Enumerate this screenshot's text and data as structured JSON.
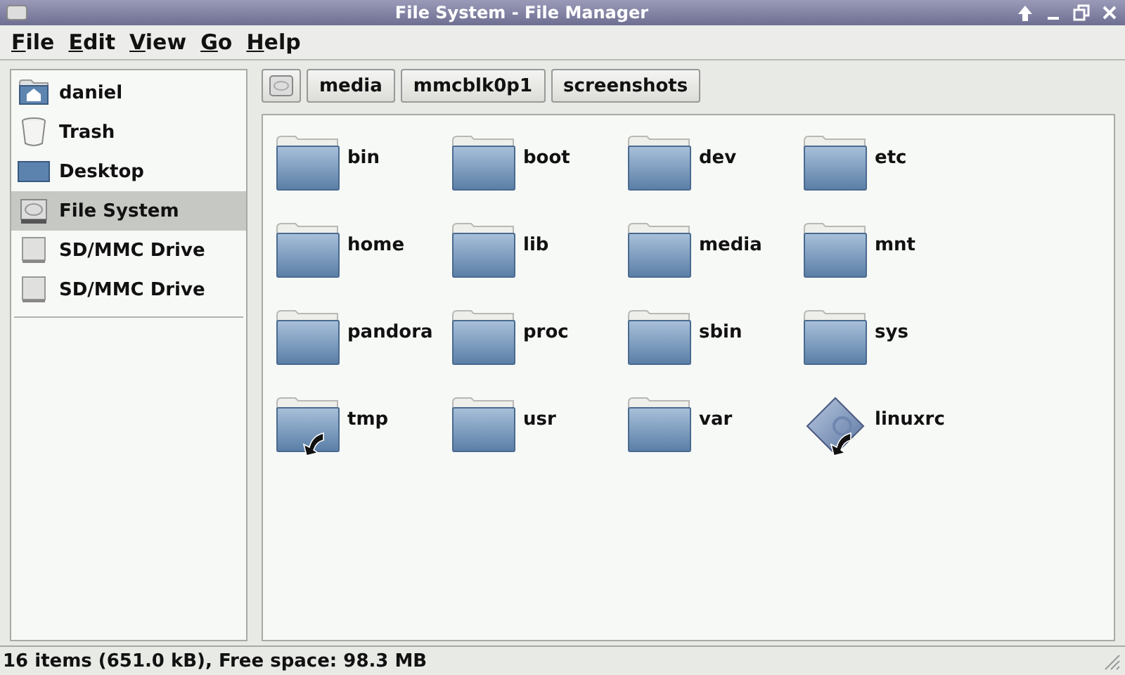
{
  "window": {
    "title": "File System - File Manager"
  },
  "menu": [
    {
      "label": "File"
    },
    {
      "label": "Edit"
    },
    {
      "label": "View"
    },
    {
      "label": "Go"
    },
    {
      "label": "Help"
    }
  ],
  "sidebar": {
    "items": [
      {
        "label": "daniel",
        "kind": "home",
        "selected": false
      },
      {
        "label": "Trash",
        "kind": "trash",
        "selected": false
      },
      {
        "label": "Desktop",
        "kind": "desktop",
        "selected": false
      },
      {
        "label": "File System",
        "kind": "drive",
        "selected": true
      },
      {
        "label": "SD/MMC Drive",
        "kind": "removable",
        "selected": false
      },
      {
        "label": "SD/MMC Drive",
        "kind": "removable",
        "selected": false
      }
    ]
  },
  "path_bar": [
    {
      "label": "media"
    },
    {
      "label": "mmcblk0p1"
    },
    {
      "label": "screenshots"
    }
  ],
  "files": [
    {
      "name": "bin",
      "kind": "folder",
      "symlink": false
    },
    {
      "name": "boot",
      "kind": "folder",
      "symlink": false
    },
    {
      "name": "dev",
      "kind": "folder",
      "symlink": false
    },
    {
      "name": "etc",
      "kind": "folder",
      "symlink": false
    },
    {
      "name": "home",
      "kind": "folder",
      "symlink": false
    },
    {
      "name": "lib",
      "kind": "folder",
      "symlink": false
    },
    {
      "name": "media",
      "kind": "folder",
      "symlink": false
    },
    {
      "name": "mnt",
      "kind": "folder",
      "symlink": false
    },
    {
      "name": "pandora",
      "kind": "folder",
      "symlink": false
    },
    {
      "name": "proc",
      "kind": "folder",
      "symlink": false
    },
    {
      "name": "sbin",
      "kind": "folder",
      "symlink": false
    },
    {
      "name": "sys",
      "kind": "folder",
      "symlink": false
    },
    {
      "name": "tmp",
      "kind": "folder",
      "symlink": true
    },
    {
      "name": "usr",
      "kind": "folder",
      "symlink": false
    },
    {
      "name": "var",
      "kind": "folder",
      "symlink": false
    },
    {
      "name": "linuxrc",
      "kind": "executable",
      "symlink": true
    }
  ],
  "status_bar": {
    "text": "16 items (651.0 kB), Free space: 98.3 MB"
  }
}
